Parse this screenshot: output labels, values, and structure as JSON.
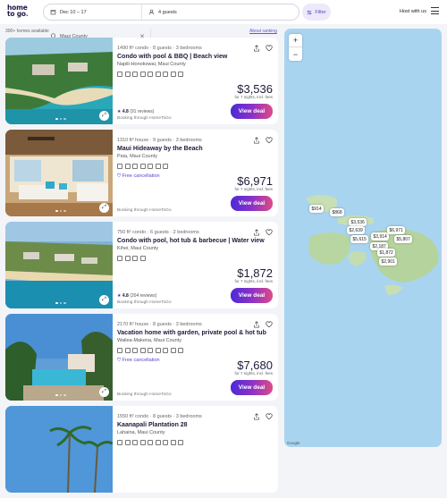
{
  "header": {
    "logo_line1": "home",
    "logo_line2": "to go",
    "location": "Maui County",
    "dates": "Dec 10 – 17",
    "guests": "4 guests",
    "filter_label": "Filter",
    "host_label": "Host with us"
  },
  "results": {
    "count_label": "300+ homes available",
    "about_label": "About ranking"
  },
  "listings": [
    {
      "meta": "1490 ft² condo · 8 guests · 3 bedrooms",
      "title": "Condo with pool & BBQ | Beach view",
      "location": "Napili-Honokowai, Maui County",
      "free_cancel": "",
      "rating": "4.8",
      "reviews": "(91 reviews)",
      "booking": "Booking through HomeToGo",
      "price": "$3,536",
      "price_sub": "for 7 nights, incl. fees",
      "cta": "View deal"
    },
    {
      "meta": "1310 ft² house · 9 guests · 3 bedrooms",
      "title": "Maui Hideaway by the Beach",
      "location": "Paia, Maui County",
      "free_cancel": "Free cancellation",
      "rating": "",
      "reviews": "",
      "booking": "Booking through HomeToGo",
      "price": "$6,971",
      "price_sub": "for 7 nights, incl. fees",
      "cta": "View deal"
    },
    {
      "meta": "750 ft² condo · 6 guests · 2 bedrooms",
      "title": "Condo with pool, hot tub & barbecue | Water view",
      "location": "Kihei, Maui County",
      "free_cancel": "",
      "rating": "4.8",
      "reviews": "(204 reviews)",
      "booking": "Booking through HomeToGo",
      "price": "$1,872",
      "price_sub": "for 7 nights, incl. fees",
      "cta": "View deal"
    },
    {
      "meta": "2170 ft² house · 8 guests · 3 bedrooms",
      "title": "Vacation home with garden, private pool & hot tub",
      "location": "Wailea-Makena, Maui County",
      "free_cancel": "Free cancellation",
      "rating": "",
      "reviews": "",
      "booking": "Booking through HomeToGo",
      "price": "$7,680",
      "price_sub": "for 7 nights, incl. fees",
      "cta": "View deal"
    },
    {
      "meta": "1550 ft² condo · 8 guests · 3 bedrooms",
      "title": "Kaanapali Plantation 28",
      "location": "Lahaina, Maui County",
      "free_cancel": "",
      "rating": "",
      "reviews": "",
      "booking": "",
      "price": "",
      "price_sub": "",
      "cta": ""
    }
  ],
  "map": {
    "zoom_in": "+",
    "zoom_out": "−",
    "pins": [
      "$914",
      "$868",
      "$3,536",
      "$2,639",
      "$3,914",
      "$6,971",
      "$5,615",
      "$2,187",
      "$5,807",
      "$1,872",
      "$2,901"
    ],
    "attribution": "Google"
  },
  "colors": {
    "accent": "#5b3fd1",
    "cta_gradient_start": "#4b2bd6",
    "cta_gradient_end": "#e04a86",
    "map_water": "#a9d4f0"
  }
}
